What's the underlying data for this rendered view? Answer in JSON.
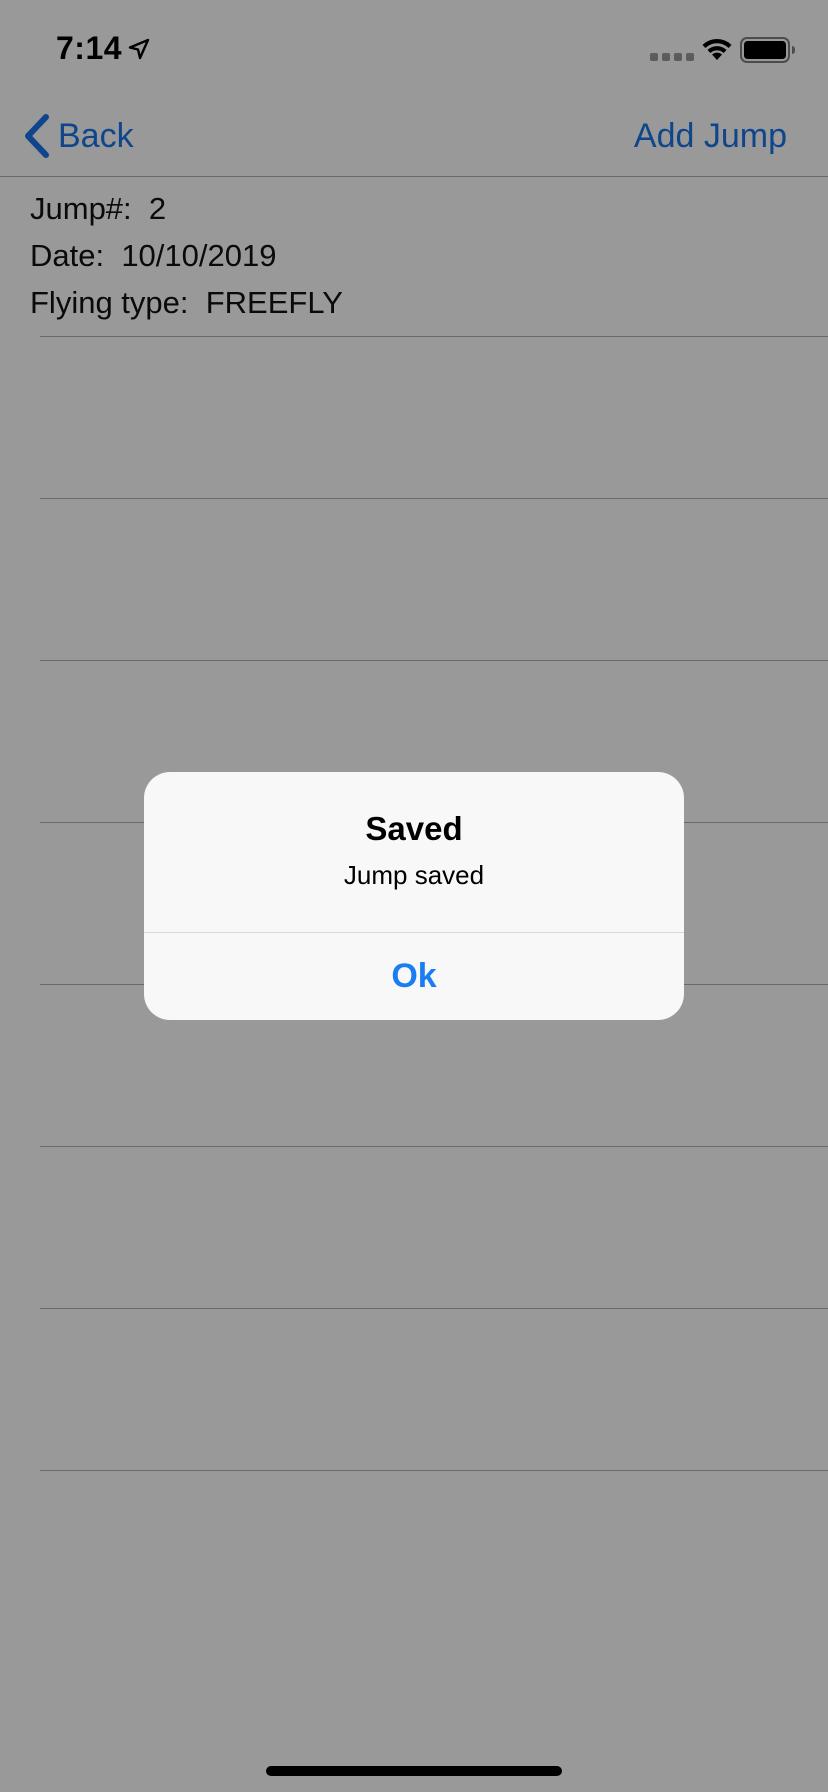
{
  "status_bar": {
    "time": "7:14",
    "icons": [
      "location-arrow-icon",
      "signal-dots-icon",
      "wifi-icon",
      "battery-icon"
    ]
  },
  "nav": {
    "back_label": "Back",
    "add_label": "Add Jump",
    "tint_color": "#1a75e8"
  },
  "jump_info": {
    "jump_number": "Jump#:  2",
    "date": "Date:  10/10/2019",
    "flying_type": "Flying type:  FREEFLY"
  },
  "alert": {
    "title": "Saved",
    "message": "Jump saved",
    "button_label": "Ok",
    "button_color": "#1a7ef2"
  }
}
